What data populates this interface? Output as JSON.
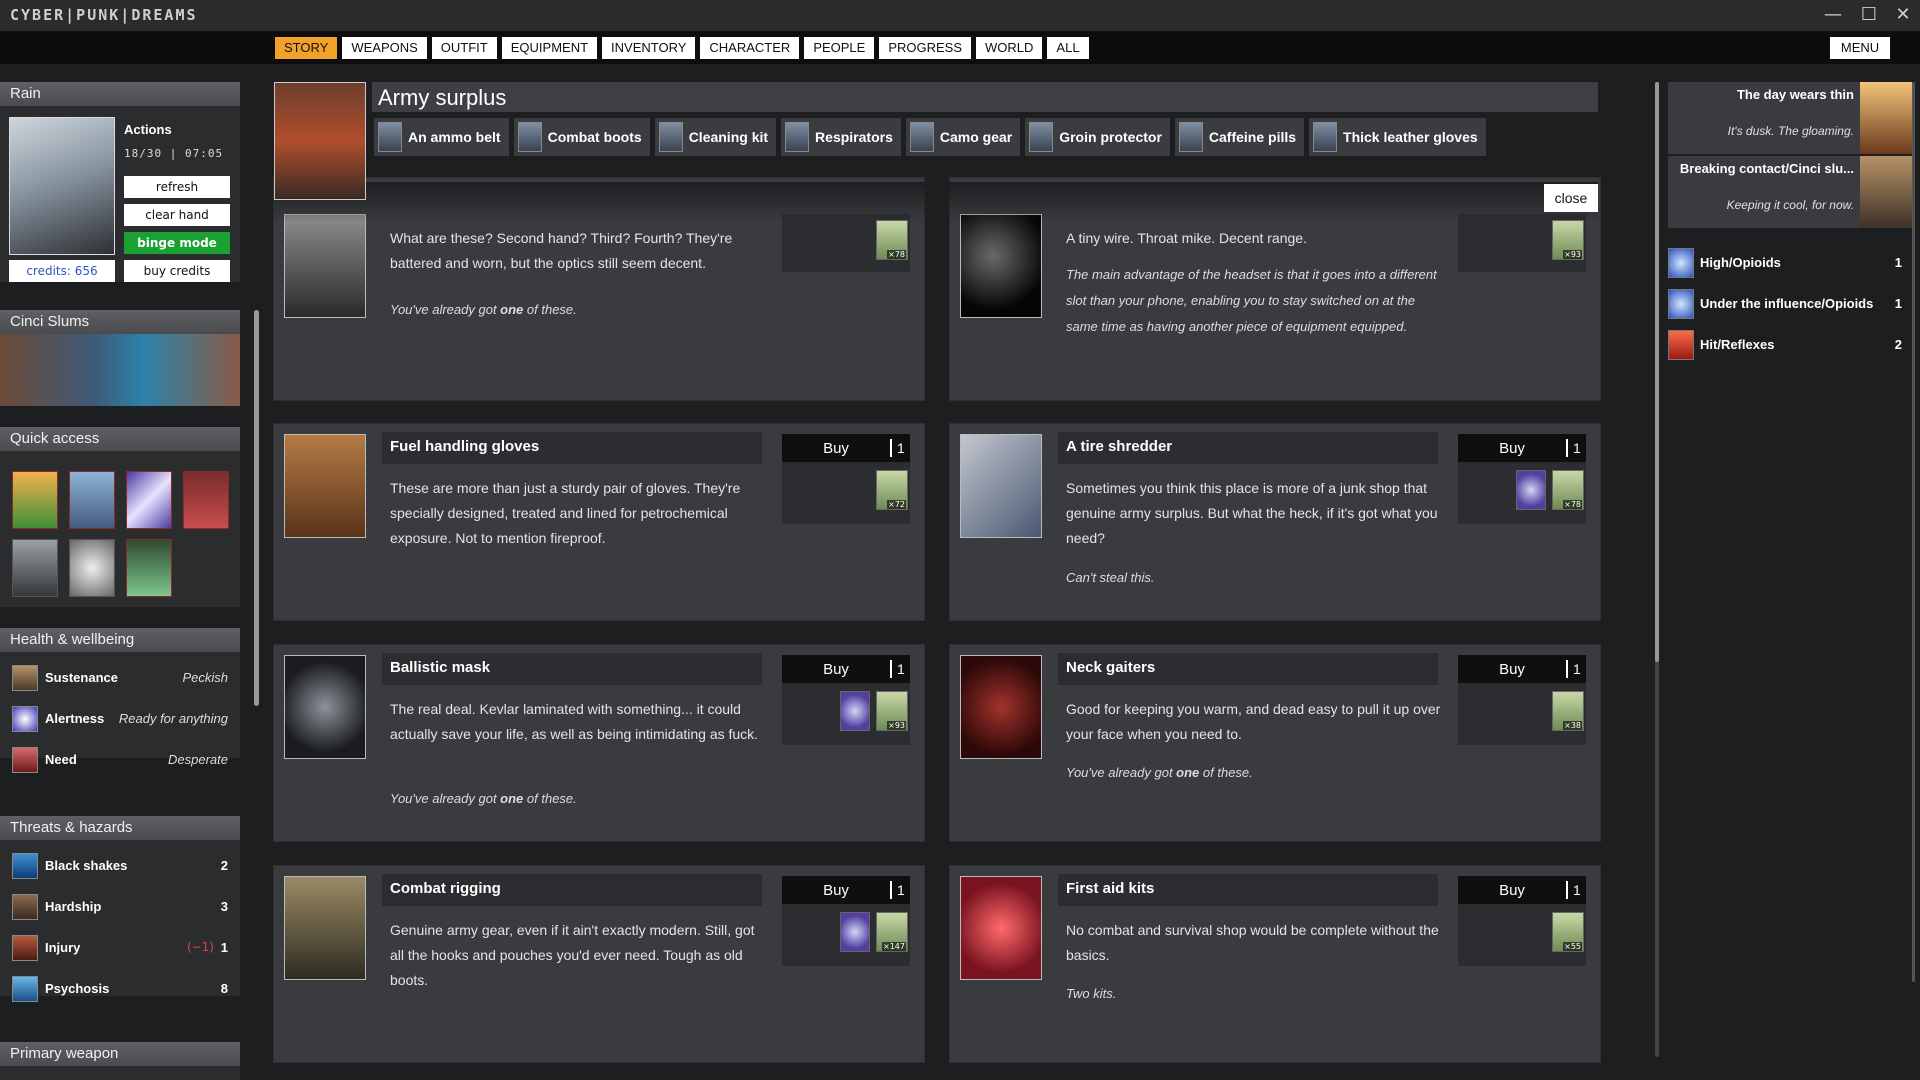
{
  "window": {
    "title": "CYBER|PUNK|DREAMS",
    "minimize": "—",
    "maximize": "☐",
    "close": "✕"
  },
  "nav": {
    "tabs": [
      "STORY",
      "WEAPONS",
      "OUTFIT",
      "EQUIPMENT",
      "INVENTORY",
      "CHARACTER",
      "PEOPLE",
      "PROGRESS",
      "WORLD",
      "ALL"
    ],
    "active": "STORY",
    "menu": "MENU"
  },
  "player": {
    "name": "Rain",
    "actions_label": "Actions",
    "actions_count": "18/30",
    "time": "07:05",
    "refresh": "refresh",
    "clear_hand": "clear hand",
    "binge_mode": "binge mode",
    "credits": "credits: 656",
    "buy_credits": "buy credits"
  },
  "location": {
    "name": "Cinci Slums"
  },
  "quick_access": {
    "title": "Quick access",
    "count": 7
  },
  "health": {
    "title": "Health & wellbeing",
    "items": [
      {
        "name": "Sustenance",
        "value": "Peckish"
      },
      {
        "name": "Alertness",
        "value": "Ready for anything"
      },
      {
        "name": "Need",
        "value": "Desperate"
      }
    ]
  },
  "threats": {
    "title": "Threats & hazards",
    "items": [
      {
        "name": "Black shakes",
        "value": "2",
        "mod": ""
      },
      {
        "name": "Hardship",
        "value": "3",
        "mod": ""
      },
      {
        "name": "Injury",
        "value": "1",
        "mod": "(−1)"
      },
      {
        "name": "Psychosis",
        "value": "8",
        "mod": ""
      }
    ]
  },
  "primary_weapon": {
    "title": "Primary weapon"
  },
  "shop": {
    "title": "Army surplus",
    "items": [
      "An ammo belt",
      "Combat boots",
      "Cleaning kit",
      "Respirators",
      "Camo gear",
      "Groin protector",
      "Caffeine pills",
      "Thick leather gloves"
    ],
    "close": "close"
  },
  "cards": [
    {
      "title": "",
      "desc": "What are these? Second hand? Third? Fourth? They're battered and worn, but the optics still seem decent.",
      "note_pre": "You've already got ",
      "note_bold": "one",
      "note_post": " of these.",
      "price": "×78"
    },
    {
      "title": "",
      "desc": "A tiny wire. Throat mike. Decent range.",
      "note": "The main advantage of the headset is that it goes into a different slot than your phone, enabling you to stay switched on at the same time as having another piece of equipment equipped.",
      "price": "×93"
    },
    {
      "title": "Fuel handling gloves",
      "desc": "These are more than just a sturdy pair of gloves. They're specially designed, treated and lined for petrochemical exposure. Not to mention fireproof.",
      "buy": "Buy",
      "qty": "1",
      "price": "×72"
    },
    {
      "title": "A tire shredder",
      "desc": "Sometimes you think this place is more of a junk shop that genuine army surplus. But what the heck, if it's got what you need?",
      "note": "Can't steal this.",
      "buy": "Buy",
      "qty": "1",
      "price": "×78"
    },
    {
      "title": "Ballistic mask",
      "desc": "The real deal. Kevlar laminated with something... it could actually save your life, as well as being intimidating as fuck.",
      "note_pre": "You've already got ",
      "note_bold": "one",
      "note_post": " of these.",
      "buy": "Buy",
      "qty": "1",
      "price": "×93"
    },
    {
      "title": "Neck gaiters",
      "desc": "Good for keeping you warm, and dead easy to pull it up over your face when you need to.",
      "note_pre": "You've already got ",
      "note_bold": "one",
      "note_post": " of these.",
      "buy": "Buy",
      "qty": "1",
      "price": "×38"
    },
    {
      "title": "Combat rigging",
      "desc": "Genuine army gear, even if it ain't exactly modern. Still, got all the hooks and pouches you'd ever need. Tough as old boots.",
      "buy": "Buy",
      "qty": "1",
      "price": "×147"
    },
    {
      "title": "First aid kits",
      "desc": "No combat and survival shop would be complete without the basics.",
      "note": "Two kits.",
      "buy": "Buy",
      "qty": "1",
      "price": "×55"
    }
  ],
  "events": [
    {
      "title": "The day wears thin",
      "subtitle": "It's dusk. The gloaming."
    },
    {
      "title": "Breaking contact/Cinci slu...",
      "subtitle": "Keeping it cool, for now."
    }
  ],
  "statuses": [
    {
      "name": "High/Opioids",
      "value": "1"
    },
    {
      "name": "Under the influence/Opioids",
      "value": "1"
    },
    {
      "name": "Hit/Reflexes",
      "value": "2"
    }
  ]
}
